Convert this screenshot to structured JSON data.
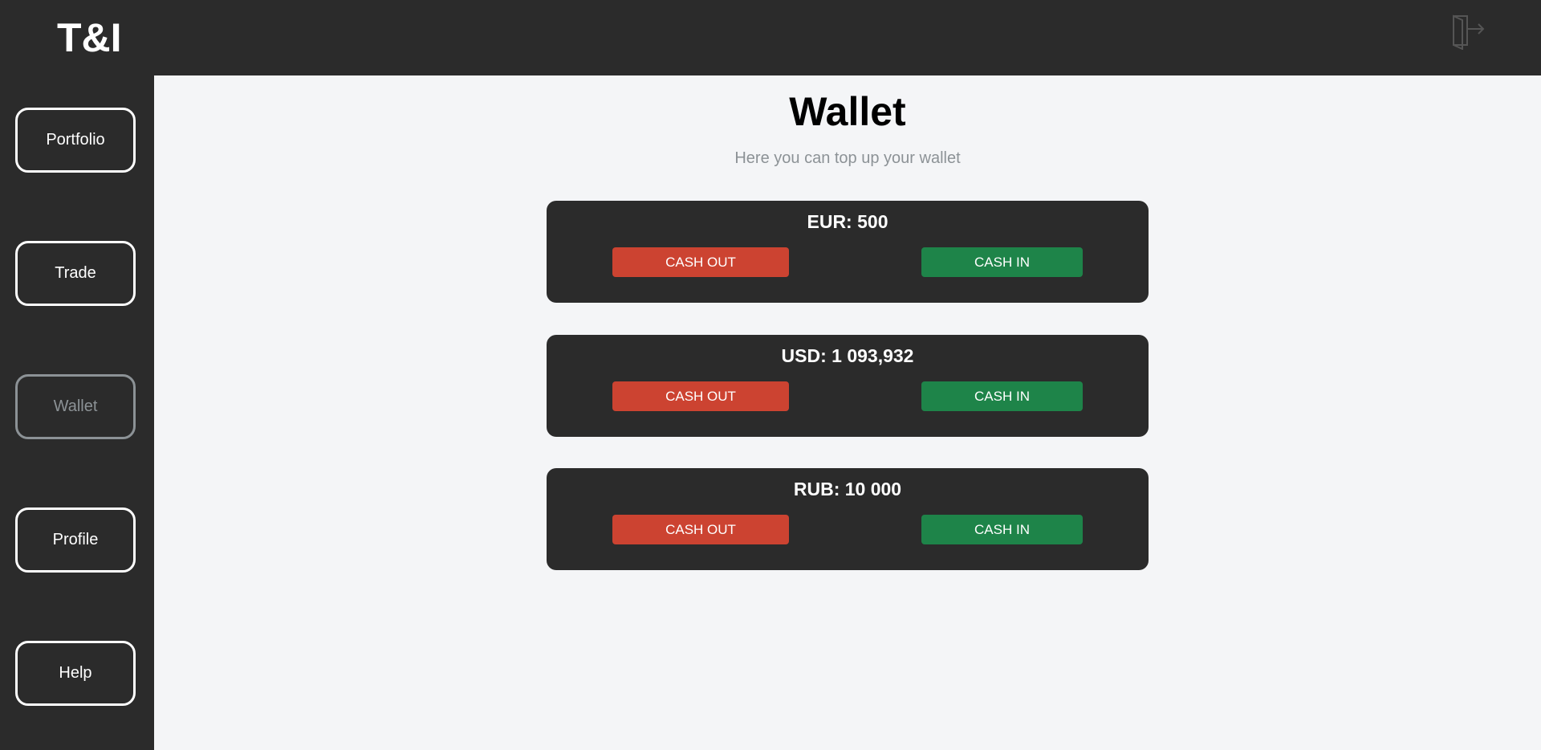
{
  "header": {
    "logo": "T&I",
    "logout_icon": "logout-door-icon"
  },
  "sidebar": {
    "items": [
      {
        "label": "Portfolio",
        "active": false
      },
      {
        "label": "Trade",
        "active": false
      },
      {
        "label": "Wallet",
        "active": true
      },
      {
        "label": "Profile",
        "active": false
      },
      {
        "label": "Help",
        "active": false
      }
    ]
  },
  "main": {
    "title": "Wallet",
    "subtitle": "Here you can top up your wallet",
    "wallets": [
      {
        "amount": "EUR: 500",
        "cash_out_label": "CASH OUT",
        "cash_in_label": "CASH IN"
      },
      {
        "amount": "USD: 1 093,932",
        "cash_out_label": "CASH OUT",
        "cash_in_label": "CASH IN"
      },
      {
        "amount": "RUB: 10 000",
        "cash_out_label": "CASH OUT",
        "cash_in_label": "CASH IN"
      }
    ]
  },
  "colors": {
    "dark_bg": "#2b2b2b",
    "page_bg": "#f4f5f7",
    "cash_out": "#cc4331",
    "cash_in": "#1e8449",
    "muted": "#8c9296"
  }
}
